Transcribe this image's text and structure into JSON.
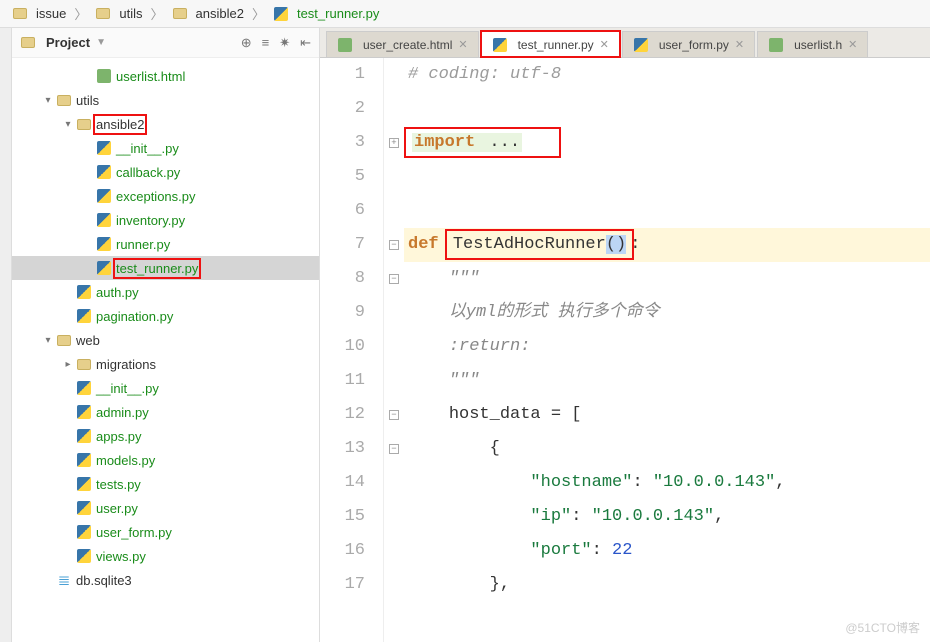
{
  "breadcrumb": [
    {
      "label": "issue",
      "icon": "folder"
    },
    {
      "label": "utils",
      "icon": "folder"
    },
    {
      "label": "ansible2",
      "icon": "folder"
    },
    {
      "label": "test_runner.py",
      "icon": "py",
      "green": true
    }
  ],
  "project": {
    "title": "Project",
    "tools": [
      "target-icon",
      "filter-icon",
      "gear-icon",
      "collapse-icon"
    ]
  },
  "tree": [
    {
      "depth": 3,
      "icon": "html",
      "label": "userlist.html",
      "green": true
    },
    {
      "depth": 1,
      "icon": "folder",
      "label": "utils",
      "twisty": "open"
    },
    {
      "depth": 2,
      "icon": "folder",
      "label": "ansible2",
      "twisty": "open",
      "redbox": true
    },
    {
      "depth": 3,
      "icon": "py",
      "label": "__init__.py",
      "green": true
    },
    {
      "depth": 3,
      "icon": "py",
      "label": "callback.py",
      "green": true
    },
    {
      "depth": 3,
      "icon": "py",
      "label": "exceptions.py",
      "green": true
    },
    {
      "depth": 3,
      "icon": "py",
      "label": "inventory.py",
      "green": true
    },
    {
      "depth": 3,
      "icon": "py",
      "label": "runner.py",
      "green": true
    },
    {
      "depth": 3,
      "icon": "py",
      "label": "test_runner.py",
      "green": true,
      "redbox": true,
      "selected": true
    },
    {
      "depth": 2,
      "icon": "py",
      "label": "auth.py",
      "green": true
    },
    {
      "depth": 2,
      "icon": "py",
      "label": "pagination.py",
      "green": true
    },
    {
      "depth": 1,
      "icon": "folder",
      "label": "web",
      "twisty": "open"
    },
    {
      "depth": 2,
      "icon": "folder",
      "label": "migrations",
      "twisty": "closed"
    },
    {
      "depth": 2,
      "icon": "py",
      "label": "__init__.py",
      "green": true
    },
    {
      "depth": 2,
      "icon": "py",
      "label": "admin.py",
      "green": true
    },
    {
      "depth": 2,
      "icon": "py",
      "label": "apps.py",
      "green": true
    },
    {
      "depth": 2,
      "icon": "py",
      "label": "models.py",
      "green": true
    },
    {
      "depth": 2,
      "icon": "py",
      "label": "tests.py",
      "green": true
    },
    {
      "depth": 2,
      "icon": "py",
      "label": "user.py",
      "green": true
    },
    {
      "depth": 2,
      "icon": "py",
      "label": "user_form.py",
      "green": true
    },
    {
      "depth": 2,
      "icon": "py",
      "label": "views.py",
      "green": true
    },
    {
      "depth": 1,
      "icon": "db",
      "label": "db.sqlite3"
    }
  ],
  "tabs": [
    {
      "label": "user_create.html",
      "icon": "html"
    },
    {
      "label": "test_runner.py",
      "icon": "py",
      "active": true,
      "redbox": true
    },
    {
      "label": "user_form.py",
      "icon": "py"
    },
    {
      "label": "userlist.h",
      "icon": "html"
    }
  ],
  "code": {
    "lines": [
      {
        "n": 1,
        "html": "<span class='c-comment'># coding: utf-8</span>"
      },
      {
        "n": 2,
        "html": ""
      },
      {
        "n": 3,
        "html": "<span class='redbox-span'><span class='c-kw fold-bg'>import</span><span class='fold-bg'> ...</span>   </span>",
        "foldbox": "plus"
      },
      {
        "n": 5,
        "html": ""
      },
      {
        "n": 6,
        "html": ""
      },
      {
        "n": 7,
        "html": "<span class='c-kw'>def</span> <span class='redbox-span'><span class='c-fn'>TestAdHocRunner</span><span class='sel'>()</span></span>:",
        "current": true,
        "foldbox": "minus"
      },
      {
        "n": 8,
        "html": "    <span class='c-doc'>&#34;&#34;&#34;</span>",
        "foldbox": "minus"
      },
      {
        "n": 9,
        "html": "    <span class='c-doc'>以yml的形式 执行多个命令</span>"
      },
      {
        "n": 10,
        "html": "    <span class='c-doc'>:return:</span>"
      },
      {
        "n": 11,
        "html": "    <span class='c-doc'>&#34;&#34;&#34;</span>"
      },
      {
        "n": 12,
        "html": "    <span class='c-id'>host_data</span> = [",
        "foldbox": "minus"
      },
      {
        "n": 13,
        "html": "        {",
        "foldbox": "minus"
      },
      {
        "n": 14,
        "html": "            <span class='c-str'>&#34;hostname&#34;</span>: <span class='c-str'>&#34;10.0.0.143&#34;</span>,"
      },
      {
        "n": 15,
        "html": "            <span class='c-str'>&#34;ip&#34;</span>: <span class='c-str'>&#34;10.0.0.143&#34;</span>,"
      },
      {
        "n": 16,
        "html": "            <span class='c-str'>&#34;port&#34;</span>: <span class='c-num'>22</span>"
      },
      {
        "n": 17,
        "html": "        },"
      }
    ]
  },
  "watermark": "@51CTO博客"
}
